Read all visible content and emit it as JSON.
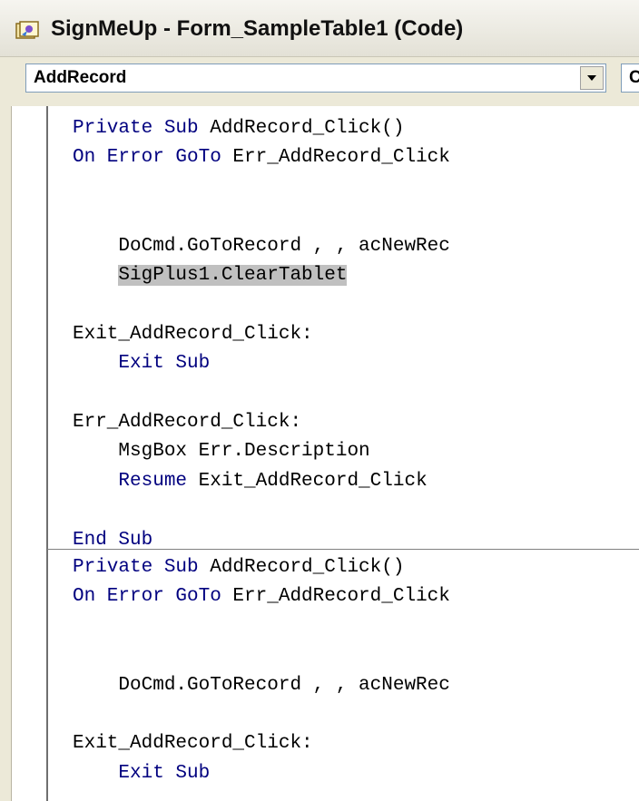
{
  "window": {
    "title": "SignMeUp - Form_SampleTable1 (Code)"
  },
  "toolbar": {
    "object_combo_value": "AddRecord",
    "procedure_combo_value": "C"
  },
  "code_procedures": [
    {
      "lines": [
        [
          "Private Sub",
          " AddRecord_Click()"
        ],
        [
          "On Error GoTo",
          " Err_AddRecord_Click"
        ],
        [
          "",
          ""
        ],
        [
          "",
          ""
        ],
        [
          "",
          "    DoCmd.GoToRecord , , acNewRec"
        ],
        [
          "",
          "    SigPlus1.ClearTablet"
        ],
        [
          "",
          ""
        ],
        [
          "",
          "Exit_AddRecord_Click:"
        ],
        [
          "    Exit Sub",
          ""
        ],
        [
          "",
          ""
        ],
        [
          "",
          "Err_AddRecord_Click:"
        ],
        [
          "",
          "    MsgBox Err.Description"
        ],
        [
          "    Resume",
          " Exit_AddRecord_Click"
        ],
        [
          "",
          ""
        ],
        [
          "End Sub",
          ""
        ]
      ]
    },
    {
      "lines": [
        [
          "Private Sub",
          " AddRecord_Click()"
        ],
        [
          "On Error GoTo",
          " Err_AddRecord_Click"
        ],
        [
          "",
          ""
        ],
        [
          "",
          ""
        ],
        [
          "",
          "    DoCmd.GoToRecord , , acNewRec"
        ],
        [
          "",
          ""
        ],
        [
          "",
          "Exit_AddRecord_Click:"
        ],
        [
          "    Exit Sub",
          ""
        ]
      ]
    }
  ],
  "colors": {
    "keyword": "#00007f",
    "highlight": "#c0c0c0"
  }
}
